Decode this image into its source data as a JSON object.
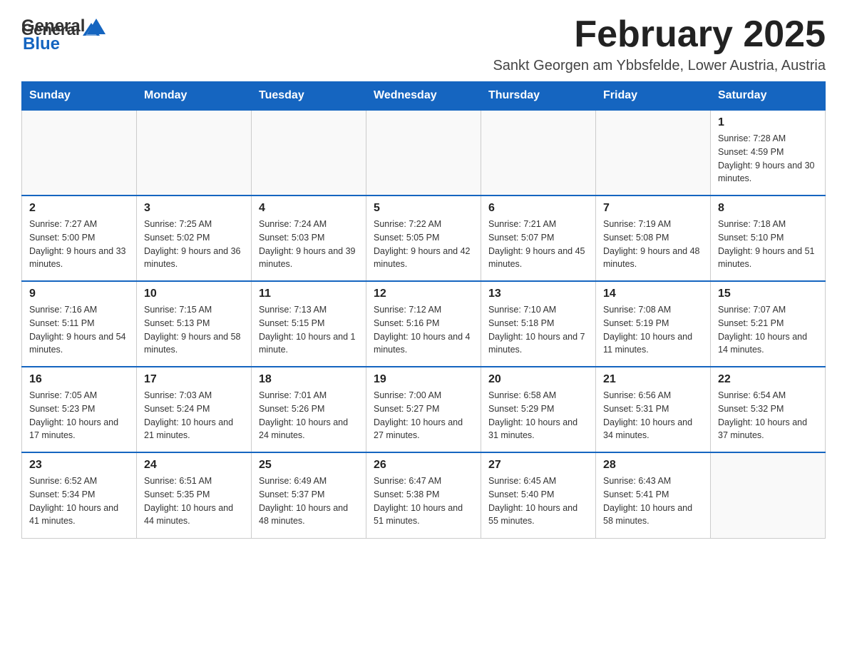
{
  "header": {
    "logo_text_general": "General",
    "logo_text_blue": "Blue",
    "month_title": "February 2025",
    "location": "Sankt Georgen am Ybbsfelde, Lower Austria, Austria"
  },
  "weekdays": [
    "Sunday",
    "Monday",
    "Tuesday",
    "Wednesday",
    "Thursday",
    "Friday",
    "Saturday"
  ],
  "weeks": [
    [
      {
        "day": "",
        "info": ""
      },
      {
        "day": "",
        "info": ""
      },
      {
        "day": "",
        "info": ""
      },
      {
        "day": "",
        "info": ""
      },
      {
        "day": "",
        "info": ""
      },
      {
        "day": "",
        "info": ""
      },
      {
        "day": "1",
        "info": "Sunrise: 7:28 AM\nSunset: 4:59 PM\nDaylight: 9 hours and 30 minutes."
      }
    ],
    [
      {
        "day": "2",
        "info": "Sunrise: 7:27 AM\nSunset: 5:00 PM\nDaylight: 9 hours and 33 minutes."
      },
      {
        "day": "3",
        "info": "Sunrise: 7:25 AM\nSunset: 5:02 PM\nDaylight: 9 hours and 36 minutes."
      },
      {
        "day": "4",
        "info": "Sunrise: 7:24 AM\nSunset: 5:03 PM\nDaylight: 9 hours and 39 minutes."
      },
      {
        "day": "5",
        "info": "Sunrise: 7:22 AM\nSunset: 5:05 PM\nDaylight: 9 hours and 42 minutes."
      },
      {
        "day": "6",
        "info": "Sunrise: 7:21 AM\nSunset: 5:07 PM\nDaylight: 9 hours and 45 minutes."
      },
      {
        "day": "7",
        "info": "Sunrise: 7:19 AM\nSunset: 5:08 PM\nDaylight: 9 hours and 48 minutes."
      },
      {
        "day": "8",
        "info": "Sunrise: 7:18 AM\nSunset: 5:10 PM\nDaylight: 9 hours and 51 minutes."
      }
    ],
    [
      {
        "day": "9",
        "info": "Sunrise: 7:16 AM\nSunset: 5:11 PM\nDaylight: 9 hours and 54 minutes."
      },
      {
        "day": "10",
        "info": "Sunrise: 7:15 AM\nSunset: 5:13 PM\nDaylight: 9 hours and 58 minutes."
      },
      {
        "day": "11",
        "info": "Sunrise: 7:13 AM\nSunset: 5:15 PM\nDaylight: 10 hours and 1 minute."
      },
      {
        "day": "12",
        "info": "Sunrise: 7:12 AM\nSunset: 5:16 PM\nDaylight: 10 hours and 4 minutes."
      },
      {
        "day": "13",
        "info": "Sunrise: 7:10 AM\nSunset: 5:18 PM\nDaylight: 10 hours and 7 minutes."
      },
      {
        "day": "14",
        "info": "Sunrise: 7:08 AM\nSunset: 5:19 PM\nDaylight: 10 hours and 11 minutes."
      },
      {
        "day": "15",
        "info": "Sunrise: 7:07 AM\nSunset: 5:21 PM\nDaylight: 10 hours and 14 minutes."
      }
    ],
    [
      {
        "day": "16",
        "info": "Sunrise: 7:05 AM\nSunset: 5:23 PM\nDaylight: 10 hours and 17 minutes."
      },
      {
        "day": "17",
        "info": "Sunrise: 7:03 AM\nSunset: 5:24 PM\nDaylight: 10 hours and 21 minutes."
      },
      {
        "day": "18",
        "info": "Sunrise: 7:01 AM\nSunset: 5:26 PM\nDaylight: 10 hours and 24 minutes."
      },
      {
        "day": "19",
        "info": "Sunrise: 7:00 AM\nSunset: 5:27 PM\nDaylight: 10 hours and 27 minutes."
      },
      {
        "day": "20",
        "info": "Sunrise: 6:58 AM\nSunset: 5:29 PM\nDaylight: 10 hours and 31 minutes."
      },
      {
        "day": "21",
        "info": "Sunrise: 6:56 AM\nSunset: 5:31 PM\nDaylight: 10 hours and 34 minutes."
      },
      {
        "day": "22",
        "info": "Sunrise: 6:54 AM\nSunset: 5:32 PM\nDaylight: 10 hours and 37 minutes."
      }
    ],
    [
      {
        "day": "23",
        "info": "Sunrise: 6:52 AM\nSunset: 5:34 PM\nDaylight: 10 hours and 41 minutes."
      },
      {
        "day": "24",
        "info": "Sunrise: 6:51 AM\nSunset: 5:35 PM\nDaylight: 10 hours and 44 minutes."
      },
      {
        "day": "25",
        "info": "Sunrise: 6:49 AM\nSunset: 5:37 PM\nDaylight: 10 hours and 48 minutes."
      },
      {
        "day": "26",
        "info": "Sunrise: 6:47 AM\nSunset: 5:38 PM\nDaylight: 10 hours and 51 minutes."
      },
      {
        "day": "27",
        "info": "Sunrise: 6:45 AM\nSunset: 5:40 PM\nDaylight: 10 hours and 55 minutes."
      },
      {
        "day": "28",
        "info": "Sunrise: 6:43 AM\nSunset: 5:41 PM\nDaylight: 10 hours and 58 minutes."
      },
      {
        "day": "",
        "info": ""
      }
    ]
  ]
}
